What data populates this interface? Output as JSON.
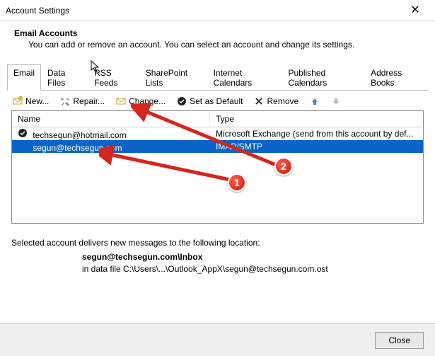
{
  "window": {
    "title": "Account Settings"
  },
  "header": {
    "title": "Email Accounts",
    "subtitle": "You can add or remove an account. You can select an account and change its settings."
  },
  "tabs": {
    "items": [
      {
        "label": "Email"
      },
      {
        "label": "Data Files"
      },
      {
        "label": "RSS Feeds"
      },
      {
        "label": "SharePoint Lists"
      },
      {
        "label": "Internet Calendars"
      },
      {
        "label": "Published Calendars"
      },
      {
        "label": "Address Books"
      }
    ],
    "active_index": 0
  },
  "toolbar": {
    "new_label": "New...",
    "repair_label": "Repair...",
    "change_label": "Change...",
    "default_label": "Set as Default",
    "remove_label": "Remove"
  },
  "columns": {
    "name": "Name",
    "type": "Type"
  },
  "accounts": [
    {
      "name": "techsegun@hotmail.com",
      "type": "Microsoft Exchange (send from this account by def...",
      "default": true,
      "selected": false
    },
    {
      "name": "segun@techsegun.com",
      "type": "IMAP/SMTP",
      "default": false,
      "selected": true
    }
  ],
  "location": {
    "intro": "Selected account delivers new messages to the following location:",
    "folder": "segun@techsegun.com\\Inbox",
    "datafile": "in data file C:\\Users\\...\\Outlook_AppX\\segun@techsegun.com.ost"
  },
  "footer": {
    "close_label": "Close"
  },
  "annotations": {
    "badge1": "1",
    "badge2": "2"
  }
}
